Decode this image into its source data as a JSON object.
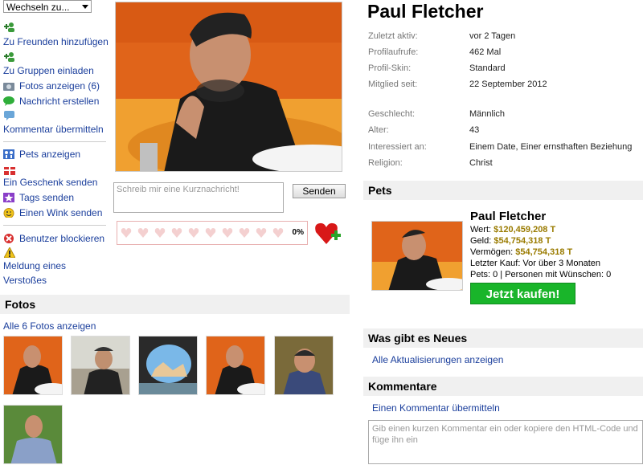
{
  "left": {
    "switch_label": "Wechseln zu...",
    "actions": [
      "Zu Freunden hinzufügen",
      "Zu Gruppen einladen",
      "Fotos anzeigen (6)",
      "Nachricht erstellen",
      "Kommentar übermitteln",
      "Pets anzeigen",
      "Ein Geschenk senden",
      "Tags senden",
      "Einen Wink senden",
      "Benutzer blockieren",
      "Meldung eines",
      "Verstoßes"
    ],
    "message_placeholder": "Schreib mir eine Kurznachricht!",
    "send_label": "Senden",
    "hearts_percent": "0%",
    "fotos_title": "Fotos",
    "fotos_link": "Alle 6 Fotos anzeigen"
  },
  "profile": {
    "name": "Paul Fletcher",
    "info": [
      {
        "label": "Zuletzt aktiv:",
        "value": "vor 2 Tagen"
      },
      {
        "label": "Profilaufrufe:",
        "value": "462 Mal"
      },
      {
        "label": "Profil-Skin:",
        "value": "Standard"
      },
      {
        "label": "Mitglied seit:",
        "value": "22 September 2012"
      },
      {
        "label": "Geschlecht:",
        "value": "Männlich"
      },
      {
        "label": "Alter:",
        "value": "43"
      },
      {
        "label": "Interessiert an:",
        "value": "Einem Date, Einer ernsthaften Beziehung"
      },
      {
        "label": "Religion:",
        "value": "Christ"
      }
    ]
  },
  "pets": {
    "title": "Pets",
    "name": "Paul Fletcher",
    "wert_label": "Wert:",
    "wert": "$120,459,208 T",
    "geld_label": "Geld:",
    "geld": "$54,754,318 T",
    "vermoegen_label": "Vermögen:",
    "vermoegen": "$54,754,318 T",
    "letzter_kauf": "Letzter Kauf: Vor über 3 Monaten",
    "pets_line": "Pets: 0 | Personen mit Wünschen: 0",
    "buy_label": "Jetzt kaufen!"
  },
  "news": {
    "title": "Was gibt es Neues",
    "link": "Alle Aktualisierungen anzeigen"
  },
  "comments": {
    "title": "Kommentare",
    "link": "Einen Kommentar übermitteln",
    "placeholder": "Gib einen kurzen Kommentar ein oder kopiere den HTML-Code und füge ihn ein"
  }
}
